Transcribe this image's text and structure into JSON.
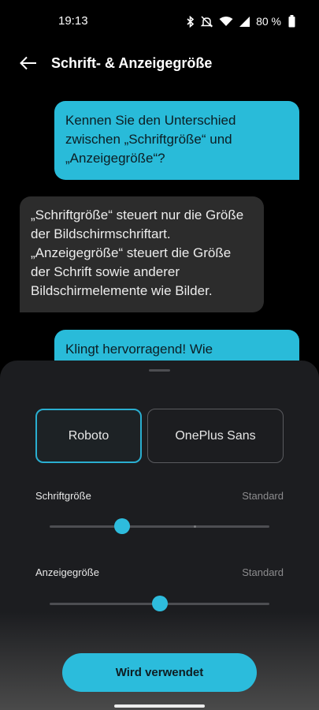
{
  "status_bar": {
    "time": "19:13",
    "battery": "80 %",
    "icons": [
      "bluetooth-icon",
      "mute-icon",
      "wifi-icon",
      "signal-icon",
      "battery-icon"
    ]
  },
  "header": {
    "title": "Schrift- & Anzeigegröße",
    "back_icon": "arrow-left-icon"
  },
  "chat": [
    {
      "direction": "outgoing",
      "text": "Kennen Sie den Unterschied zwischen „Schriftgröße“ und „Anzeigegröße“?"
    },
    {
      "direction": "incoming",
      "text": "„Schriftgröße“ steuert nur die Größe der Bildschirmschriftart. „Anzeigegröße“ steuert die Größe der Schrift sowie anderer Bildschirmelemente wie Bilder."
    },
    {
      "direction": "outgoing",
      "text": "Klingt hervorragend! Wie"
    }
  ],
  "sheet": {
    "font_options": [
      {
        "label": "Roboto",
        "selected": true
      },
      {
        "label": "OnePlus Sans",
        "selected": false
      }
    ],
    "schriftgroesse": {
      "label": "Schriftgröße",
      "value_text": "Standard",
      "position": 0.33,
      "ticks": [
        0,
        0.33,
        0.66,
        1
      ]
    },
    "anzeigegroesse": {
      "label": "Anzeigegröße",
      "value_text": "Standard",
      "position": 0.5,
      "ticks": [
        0,
        0.5,
        1
      ]
    },
    "apply_button": "Wird verwendet"
  },
  "colors": {
    "accent": "#2bbcdc",
    "outgoing_bubble": "#29bbd9",
    "incoming_bubble": "#2c2c2c",
    "sheet_background": "#1c1d20"
  }
}
